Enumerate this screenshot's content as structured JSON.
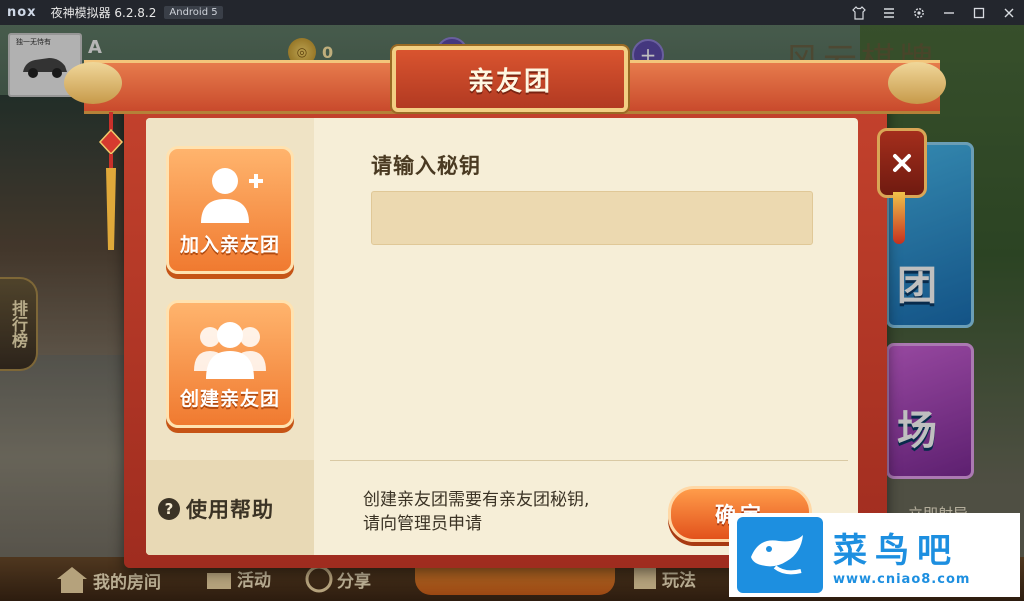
{
  "emulator": {
    "logo": "nox",
    "title": "夜神模拟器 6.2.8.2",
    "android_badge": "Android 5",
    "icons": [
      "shirt-icon",
      "menu-icon",
      "gear-icon",
      "minimize-icon",
      "maximize-icon",
      "close-icon"
    ]
  },
  "game": {
    "avatar_tag": "独一无恃有",
    "player_name": "A",
    "coins": "0",
    "logo_text": "风云棋牌",
    "rank_label": "排行榜",
    "side_card_blue_label": "团",
    "side_card_pink_label": "场",
    "right_hint": "立即射导",
    "bottom_nav": [
      "我的房间",
      "活动",
      "分享",
      "玩法"
    ]
  },
  "dialog": {
    "title": "亲友团",
    "join_label": "加入亲友团",
    "create_label": "创建亲友团",
    "help_label": "使用帮助",
    "input_label": "请输入秘钥",
    "input_value": "",
    "note_lines": [
      "创建亲友团需要有亲友团秘钥,",
      "请向管理员申请"
    ],
    "confirm_label": "确定"
  },
  "watermark": {
    "name": "菜鸟吧",
    "url": "www.cniao8.com"
  },
  "colors": {
    "dialog_frame": "#c4422d",
    "dialog_body": "#f6eed7",
    "button_orange": "#f07a30",
    "watermark_blue": "#1d8fe0"
  }
}
